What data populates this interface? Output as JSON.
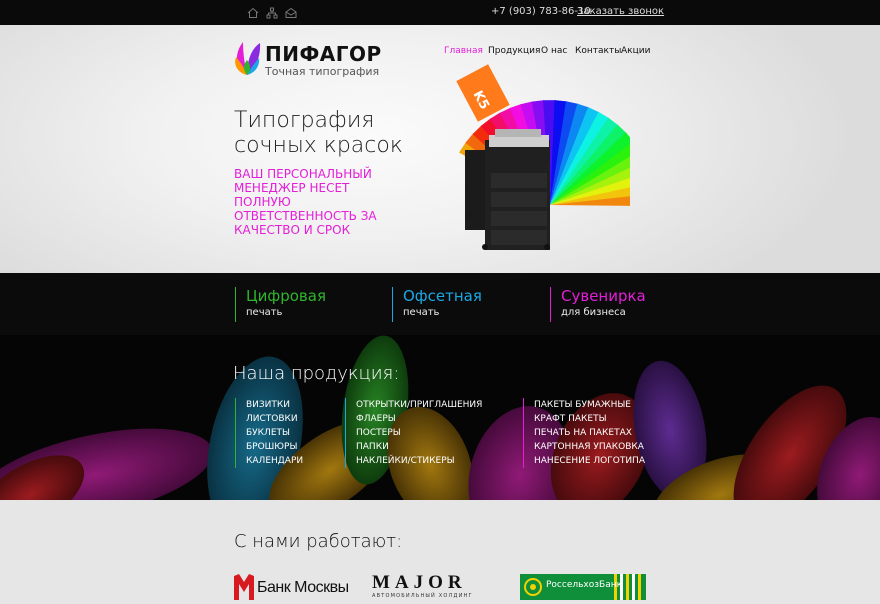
{
  "topbar": {
    "phone": "+7 (903) 783-86-10",
    "callback": "Заказать звонок",
    "icons": [
      "home-icon",
      "sitemap-icon",
      "mail-icon"
    ]
  },
  "logo": {
    "title": "ПИФАГОР",
    "subtitle": "Точная типография"
  },
  "nav": [
    {
      "label": "Главная",
      "active": true
    },
    {
      "label": "Продукция"
    },
    {
      "label": "О нас"
    },
    {
      "label": "Контакты"
    },
    {
      "label": "Акции"
    }
  ],
  "hero": {
    "title": "Типография\nсочных красок",
    "slogan": "ВАШ ПЕРСОНАЛЬНЫЙ МЕНЕДЖЕР НЕСЕТ ПОЛНУЮ ОТВЕТСТВЕННОСТЬ ЗА КАЧЕСТВО И СРОК",
    "box_label": "K5"
  },
  "services": [
    {
      "title": "Цифровая",
      "sub": "печать",
      "color": "#2fb52b"
    },
    {
      "title": "Офсетная",
      "sub": "печать",
      "color": "#1aa7e6"
    },
    {
      "title": "Сувенирка",
      "sub": "для бизнеса",
      "color": "#e41ed8"
    }
  ],
  "products": {
    "title": "Наша продукция:",
    "columns": [
      {
        "color": "#2fb52b",
        "items": [
          "Визитки",
          "Листовки",
          "Буклеты",
          "Брошюры",
          "Календари"
        ]
      },
      {
        "color": "#1aa7e6",
        "items": [
          "Открытки/приглашения",
          "Флаеры",
          "Постеры",
          "Папки",
          "Наклейки/стикеры"
        ]
      },
      {
        "color": "#e41ed8",
        "items": [
          "Пакеты бумажные",
          "Крафт пакеты",
          "Печать на пакетах",
          "Картонная упаковка",
          "Нанесение логотипа"
        ]
      }
    ]
  },
  "partners": {
    "title": "С нами работают:",
    "bank_moscow": "Банк Москвы",
    "major": "MAJOR",
    "major_sub": "АВТОМОБИЛЬНЫЙ ХОЛДИНГ",
    "rshb": "РоссельхозБанк"
  },
  "colors": {
    "accent": "#e41ed8",
    "green": "#2fb52b",
    "blue": "#1aa7e6",
    "dark": "#0b0b0b"
  }
}
